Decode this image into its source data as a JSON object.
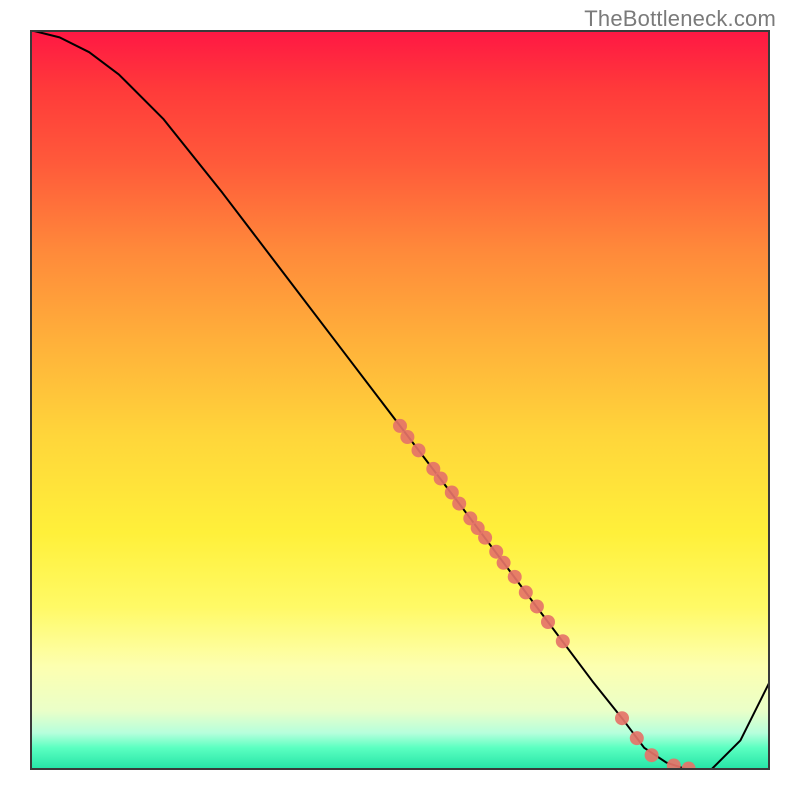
{
  "watermark": "TheBottleneck.com",
  "chart_data": {
    "type": "line",
    "title": "",
    "xlabel": "",
    "ylabel": "",
    "xlim": [
      0,
      100
    ],
    "ylim": [
      0,
      100
    ],
    "grid": false,
    "series": [
      {
        "name": "curve",
        "x": [
          0,
          4,
          8,
          12,
          18,
          26,
          34,
          42,
          50,
          58,
          64,
          70,
          76,
          80,
          83,
          86,
          89,
          92,
          96,
          100
        ],
        "y": [
          100,
          99,
          97,
          94,
          88,
          78,
          67.5,
          57,
          46.5,
          36,
          28,
          20,
          12,
          7,
          3,
          1,
          0,
          0,
          4,
          12
        ]
      }
    ],
    "scatter": {
      "name": "dots",
      "x": [
        50,
        51,
        52.5,
        54.5,
        55.5,
        57,
        58,
        59.5,
        60.5,
        61.5,
        63,
        64,
        65.5,
        67,
        68.5,
        70,
        72,
        80,
        82,
        84,
        87,
        89
      ],
      "y": [
        46.5,
        45,
        43.2,
        40.7,
        39.4,
        37.5,
        36,
        34,
        32.7,
        31.4,
        29.5,
        28,
        26.1,
        24,
        22.1,
        20,
        17.4,
        7,
        4.3,
        2,
        0.6,
        0.2
      ],
      "color": "#e57368",
      "radius": 7
    },
    "colors": {
      "line": "#000000",
      "line_width": 2
    }
  }
}
